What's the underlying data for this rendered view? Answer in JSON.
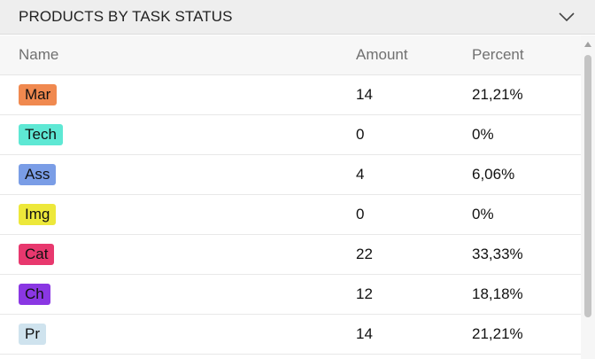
{
  "header": {
    "title": "PRODUCTS BY TASK STATUS",
    "toggle_icon": "chevron-down-icon"
  },
  "table": {
    "columns": {
      "name": "Name",
      "amount": "Amount",
      "percent": "Percent"
    },
    "rows": [
      {
        "name": "Mar",
        "color": "#f0894f",
        "amount": "14",
        "percent": "21,21%"
      },
      {
        "name": "Tech",
        "color": "#5ee8d4",
        "amount": "0",
        "percent": "0%"
      },
      {
        "name": "Ass",
        "color": "#7a9de6",
        "amount": "4",
        "percent": "6,06%"
      },
      {
        "name": "Img",
        "color": "#ede83a",
        "amount": "0",
        "percent": "0%"
      },
      {
        "name": "Cat",
        "color": "#e8386e",
        "amount": "22",
        "percent": "33,33%"
      },
      {
        "name": "Ch",
        "color": "#8a37e3",
        "amount": "12",
        "percent": "18,18%"
      },
      {
        "name": "Pr",
        "color": "#cfe3ee",
        "amount": "14",
        "percent": "21,21%"
      }
    ]
  }
}
